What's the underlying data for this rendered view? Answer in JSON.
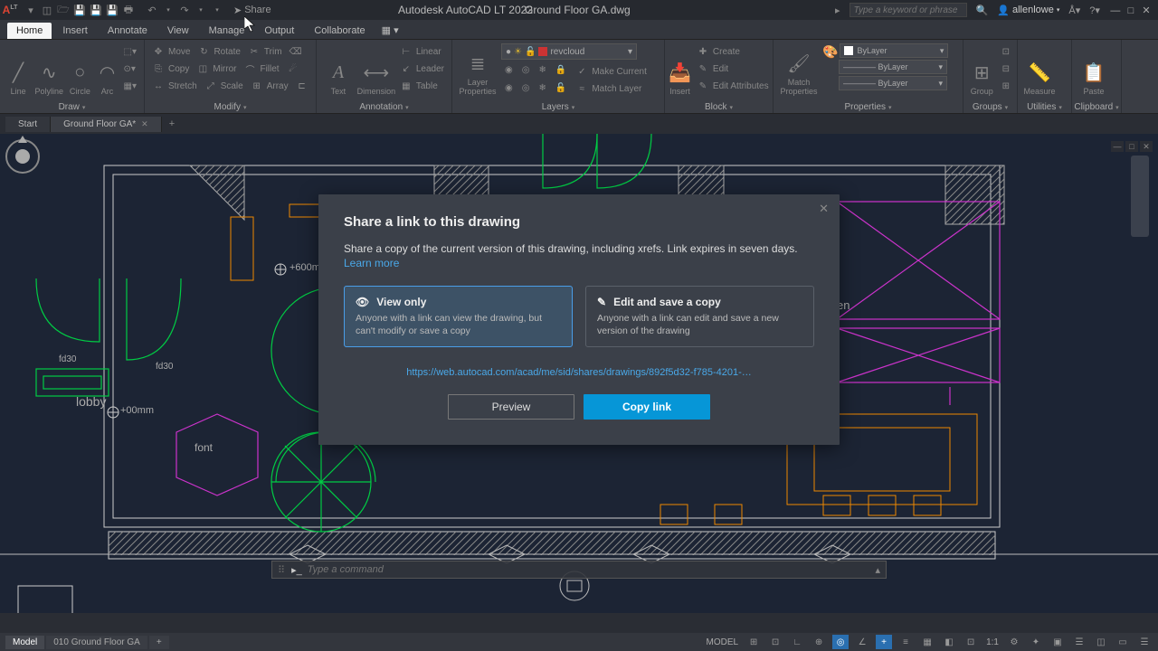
{
  "app": {
    "title": "Autodesk AutoCAD LT 2022",
    "doc": "Ground Floor  GA.dwg"
  },
  "qat_share": "Share",
  "search": {
    "placeholder": "Type a keyword or phrase"
  },
  "user": {
    "name": "allenlowe"
  },
  "menu": {
    "tabs": [
      "Home",
      "Insert",
      "Annotate",
      "View",
      "Manage",
      "Output",
      "Collaborate"
    ],
    "active": 0
  },
  "ribbon": {
    "draw": {
      "label": "Draw",
      "items": [
        "Line",
        "Polyline",
        "Circle",
        "Arc"
      ]
    },
    "modify": {
      "label": "Modify",
      "rows": [
        [
          "Move",
          "Rotate",
          "Trim"
        ],
        [
          "Copy",
          "Mirror",
          "Fillet"
        ],
        [
          "Stretch",
          "Scale",
          "Array"
        ]
      ]
    },
    "annotation": {
      "label": "Annotation",
      "items": [
        "Text",
        "Dimension"
      ],
      "rows": [
        "Linear",
        "Leader",
        "Table"
      ]
    },
    "layers": {
      "label": "Layers",
      "big": "Layer Properties",
      "current": "revcloud",
      "rows": [
        "Make Current",
        "Match Layer"
      ]
    },
    "block": {
      "label": "Block",
      "big": "Insert",
      "rows": [
        "Create",
        "Edit",
        "Edit Attributes"
      ]
    },
    "properties": {
      "label": "Properties",
      "big": "Match Properties",
      "combos": [
        "ByLayer",
        "———— ByLayer",
        "———— ByLayer"
      ]
    },
    "groups": {
      "label": "Groups",
      "big": "Group"
    },
    "utilities": {
      "label": "Utilities",
      "big": "Measure"
    },
    "clipboard": {
      "label": "Clipboard",
      "big": "Paste"
    }
  },
  "filetabs": {
    "items": [
      "Start",
      "Ground Floor  GA*"
    ],
    "active": 1
  },
  "drawing_labels": {
    "lobby": "lobby",
    "font": "font",
    "fd30a": "fd30",
    "fd30b": "fd30",
    "h600": "+600mm",
    "h0": "+00mm",
    "en": "en"
  },
  "cmd": {
    "placeholder": "Type a command"
  },
  "status": {
    "tabs": [
      "Model",
      "010 Ground Floor GA"
    ],
    "active": 0,
    "model": "MODEL",
    "scale": "1:1"
  },
  "dialog": {
    "title": "Share a link to this drawing",
    "desc": "Share a copy of the current version of this drawing, including xrefs. Link expires in seven days.",
    "learn": "Learn more",
    "opt1": {
      "title": "View only",
      "desc": "Anyone with a link can view the drawing, but can't modify or save a copy"
    },
    "opt2": {
      "title": "Edit and save a copy",
      "desc": "Anyone with a link can edit and save a new version of the drawing"
    },
    "url": "https://web.autocad.com/acad/me/sid/shares/drawings/892f5d32-f785-4201-…",
    "preview": "Preview",
    "copy": "Copy link"
  }
}
